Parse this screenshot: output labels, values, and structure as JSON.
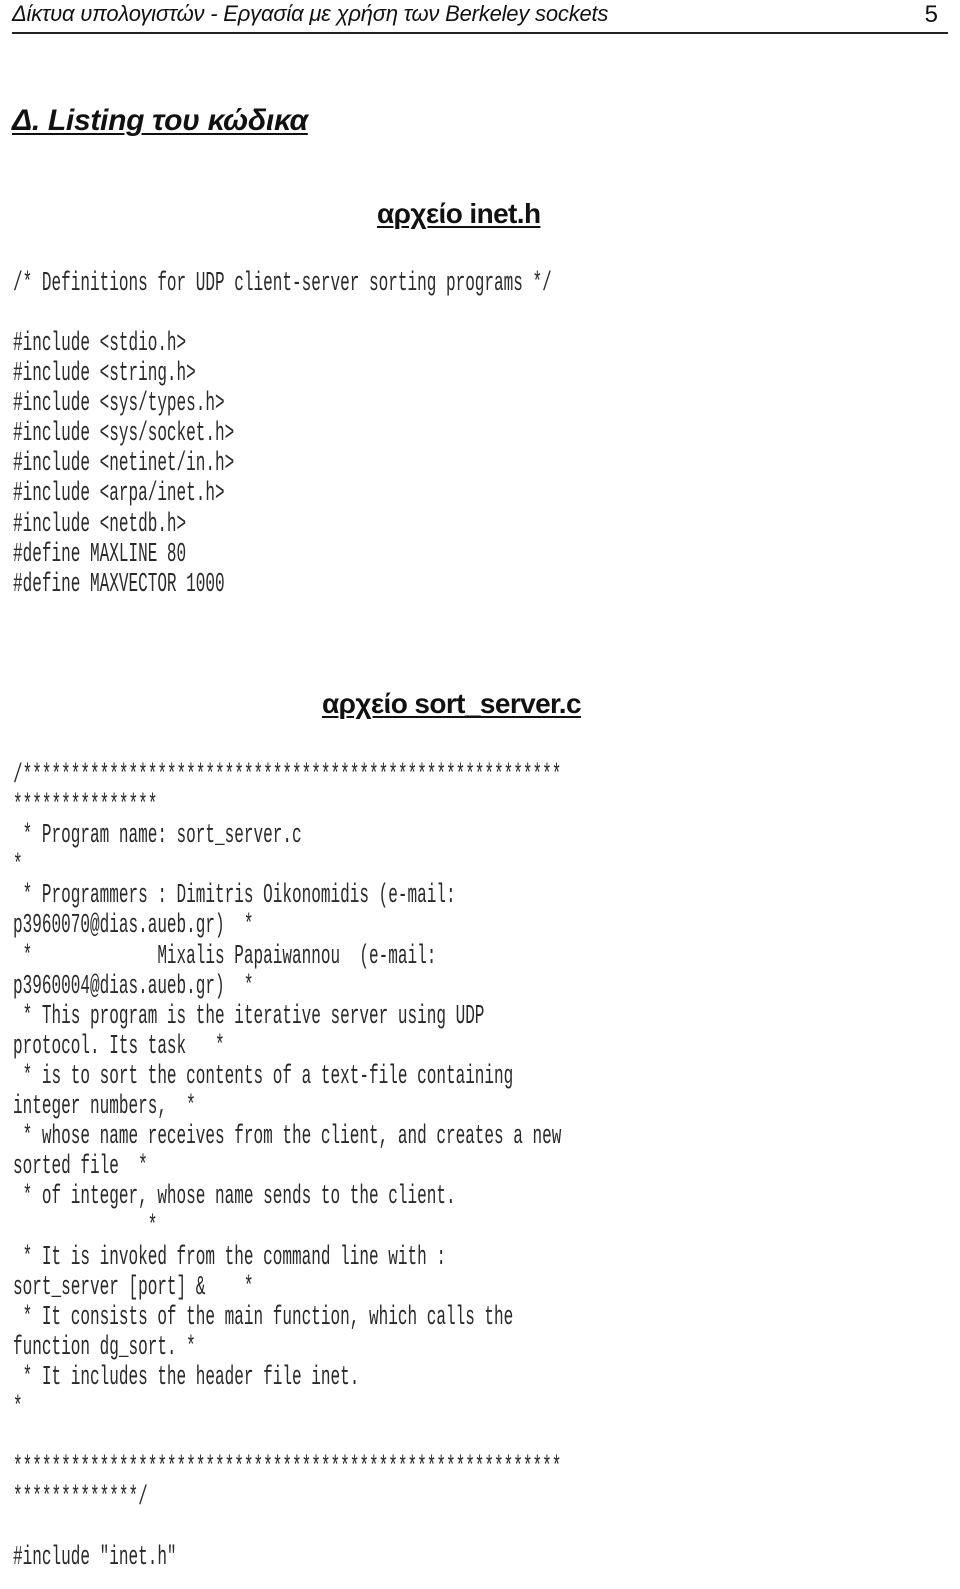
{
  "header": {
    "title": "Δίκτυα υπολογιστών - Εργασία με χρήση των Berkeley sockets",
    "page_number": "5"
  },
  "section": {
    "title": "Δ. Listing του κώδικα"
  },
  "files": [
    {
      "heading": "αρχείο inet.h",
      "comment": "/* Definitions for UDP client-server sorting programs */",
      "lines": [
        "#include <stdio.h>",
        "#include <string.h>",
        "#include <sys/types.h>",
        "#include <sys/socket.h>",
        "#include <netinet/in.h>",
        "#include <arpa/inet.h>",
        "#include <netdb.h>",
        "#define MAXLINE 80",
        "#define MAXVECTOR 1000"
      ]
    },
    {
      "heading": "αρχείο sort_server.c",
      "lines": [
        "/********************************************************",
        "***************",
        " * Program name: sort_server.c",
        "*",
        " * Programmers : Dimitris Oikonomidis (e-mail:",
        "p3960070@dias.aueb.gr)  *",
        " *             Mixalis Papaiwannou  (e-mail:",
        "p3960004@dias.aueb.gr)  *",
        " * This program is the iterative server using UDP",
        "protocol. Its task   *",
        " * is to sort the contents of a text-file containing",
        "integer numbers,  *",
        " * whose name receives from the client, and creates a new",
        "sorted file  *",
        " * of integer, whose name sends to the client.",
        "              *",
        " * It is invoked from the command line with :",
        "sort_server [port] &    *",
        " * It consists of the main function, which calls the",
        "function dg_sort. *",
        " * It includes the header file inet.",
        "*",
        "",
        "*********************************************************",
        "*************/",
        "",
        "#include \"inet.h\""
      ]
    }
  ]
}
